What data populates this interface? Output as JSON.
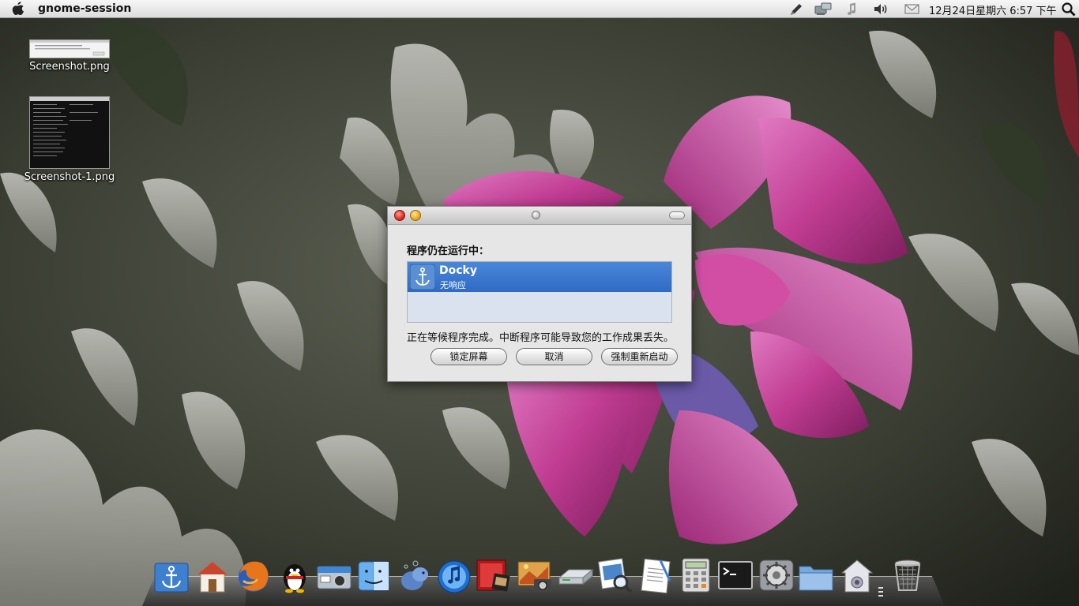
{
  "panel": {
    "app_title": "gnome-session",
    "clock": "12月24日星期六  6:57 下午",
    "icons": [
      "apple-logo-icon",
      "pen-icon",
      "network-icon",
      "music-note-icon",
      "volume-icon",
      "mail-icon",
      "search-icon"
    ]
  },
  "desktop": {
    "icons": [
      {
        "label": "Screenshot.png"
      },
      {
        "label": "Screenshot-1.png"
      }
    ]
  },
  "dialog": {
    "heading": "程序仍在运行中：",
    "app": {
      "name": "Docky",
      "status": "无响应"
    },
    "message": "正在等候程序完成。中断程序可能导致您的工作成果丢失。",
    "buttons": {
      "lock": "锁定屏幕",
      "cancel": "取消",
      "force": "强制重新启动"
    }
  },
  "dock": {
    "items": [
      "docky-anchor",
      "home-folder",
      "firefox",
      "qq",
      "camera",
      "finder",
      "pidgin",
      "itunes",
      "video",
      "image-viewer",
      "scanner",
      "preview",
      "text-editor",
      "calculator",
      "terminal",
      "system-preferences",
      "folder",
      "home",
      "trash"
    ]
  },
  "colors": {
    "accent": "#3a78cf",
    "panel": "#e6e6e6",
    "flower": "#c0408f"
  }
}
